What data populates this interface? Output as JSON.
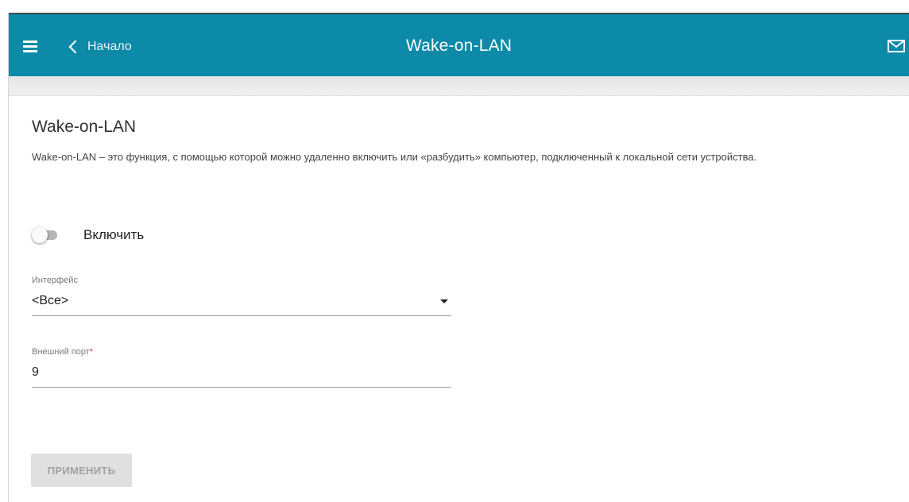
{
  "header": {
    "back_label": "Начало",
    "title": "Wake-on-LAN",
    "menu_icon": "hamburger-menu-icon",
    "back_icon": "chevron-left-icon",
    "notifications_icon": "envelope-icon",
    "background_color": "#0d8aa8"
  },
  "section": {
    "title": "Wake-on-LAN",
    "description": "Wake-on-LAN – это функция, с помощью которой можно удаленно включить или «разбудить» компьютер, подключенный к локальной сети устройства."
  },
  "enable_toggle": {
    "label": "Включить",
    "checked": false
  },
  "interface_field": {
    "label": "Интерфейс",
    "value": "<Все>"
  },
  "external_port_field": {
    "label": "Внешний порт",
    "required_mark": "*",
    "value": "9"
  },
  "apply_button": {
    "label": "ПРИМЕНИТЬ",
    "disabled": true
  }
}
